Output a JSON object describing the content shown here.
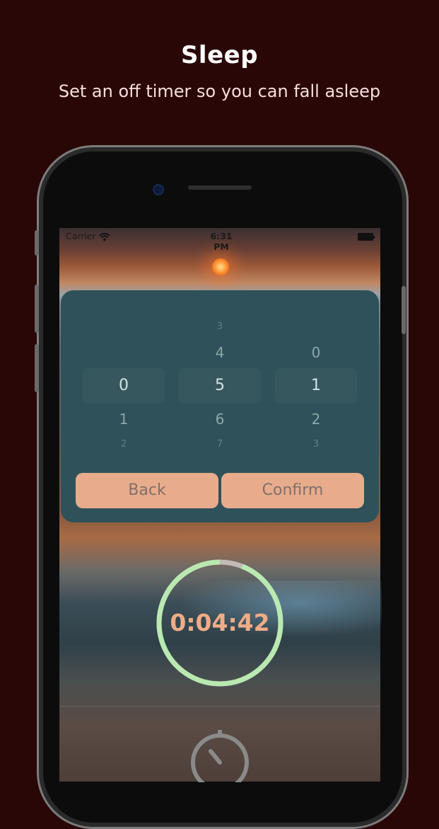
{
  "promo": {
    "title": "Sleep",
    "subtitle": "Set an off timer so you can fall asleep"
  },
  "status_bar": {
    "carrier": "Carrier",
    "time": "6:31 PM",
    "icons": [
      "wifi-icon",
      "battery-icon"
    ]
  },
  "picker": {
    "columns": [
      {
        "far_above": "",
        "above": "",
        "selected": "0",
        "below": "1",
        "far_below": "2"
      },
      {
        "far_above": "3",
        "above": "4",
        "selected": "5",
        "below": "6",
        "far_below": "7"
      },
      {
        "far_above": "",
        "above": "0",
        "selected": "1",
        "below": "2",
        "far_below": "3"
      }
    ]
  },
  "buttons": {
    "back_label": "Back",
    "confirm_label": "Confirm"
  },
  "timer": {
    "display": "0:04:42",
    "progress": 0.94,
    "ring_color": "#b9e9b0",
    "text_color": "#f0ac86"
  },
  "bottom_icon": "stopwatch-icon",
  "colors": {
    "background": "#2a0707",
    "panel": "#2f5159",
    "button": "#e8ac8c"
  }
}
